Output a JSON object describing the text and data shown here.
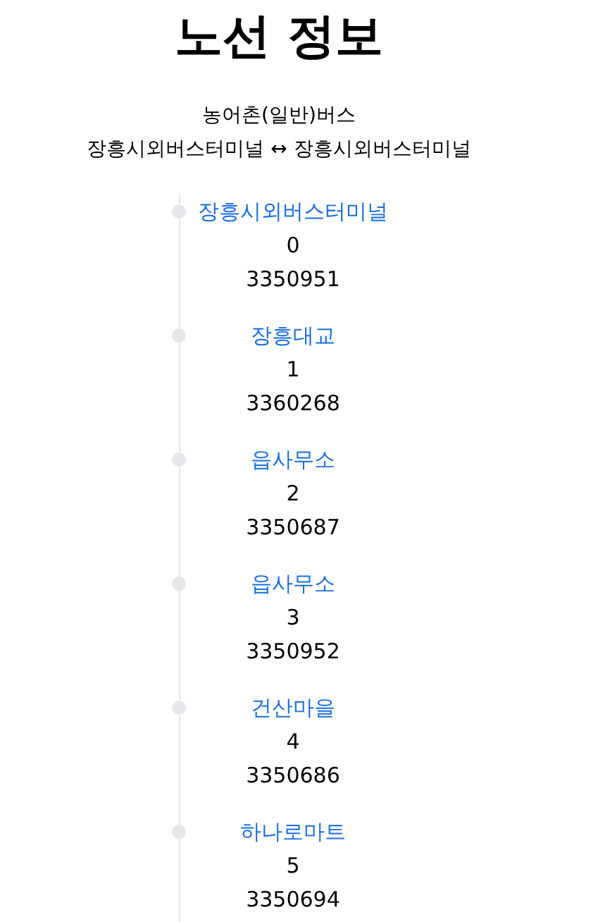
{
  "title": "노선 정보",
  "route": {
    "name": "농어촌(일반)버스",
    "endpoints": "장흥시외버스터미널 ↔ 장흥시외버스터미널"
  },
  "stops": [
    {
      "name": "장흥시외버스터미널",
      "order": "0",
      "id": "3350951"
    },
    {
      "name": "장흥대교",
      "order": "1",
      "id": "3360268"
    },
    {
      "name": "읍사무소",
      "order": "2",
      "id": "3350687"
    },
    {
      "name": "읍사무소",
      "order": "3",
      "id": "3350952"
    },
    {
      "name": "건산마을",
      "order": "4",
      "id": "3350686"
    },
    {
      "name": "하나로마트",
      "order": "5",
      "id": "3350694"
    }
  ]
}
